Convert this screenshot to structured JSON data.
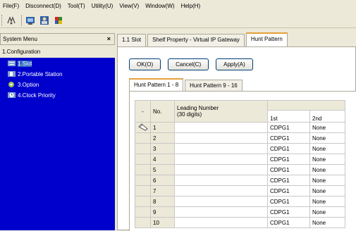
{
  "menu": [
    "File(F)",
    "Disconnect(D)",
    "Tool(T)",
    "Utility(U)",
    "View(V)",
    "Window(W)",
    "Help(H)"
  ],
  "left": {
    "title": "System Menu",
    "close": "×",
    "root": "1.Configuration",
    "items": [
      "1.Slot",
      "2.Portable Station",
      "3.Option",
      "4.Clock Priority"
    ]
  },
  "tabs": [
    "1.1 Slot",
    "Shelf Property - Virtual IP Gateway",
    "Hunt Pattern"
  ],
  "buttons": {
    "ok": "OK(O)",
    "cancel": "Cancel(C)",
    "apply": "Apply(A)"
  },
  "subtabs": [
    "Hunt Pattern 1 - 8",
    "Hunt Pattern 9 - 16"
  ],
  "table": {
    "dash": "-",
    "no_header": "No.",
    "lead_header_1": "Leading Number",
    "lead_header_2": "(30 digits)",
    "col_1st": "1st",
    "col_2nd": "2nd",
    "rows": [
      {
        "no": "1",
        "first": "CDPG1",
        "second": "None"
      },
      {
        "no": "2",
        "first": "CDPG1",
        "second": "None"
      },
      {
        "no": "3",
        "first": "CDPG1",
        "second": "None"
      },
      {
        "no": "4",
        "first": "CDPG1",
        "second": "None"
      },
      {
        "no": "5",
        "first": "CDPG1",
        "second": "None"
      },
      {
        "no": "6",
        "first": "CDPG1",
        "second": "None"
      },
      {
        "no": "7",
        "first": "CDPG1",
        "second": "None"
      },
      {
        "no": "8",
        "first": "CDPG1",
        "second": "None"
      },
      {
        "no": "9",
        "first": "CDPG1",
        "second": "None"
      },
      {
        "no": "10",
        "first": "CDPG1",
        "second": "None"
      }
    ]
  }
}
